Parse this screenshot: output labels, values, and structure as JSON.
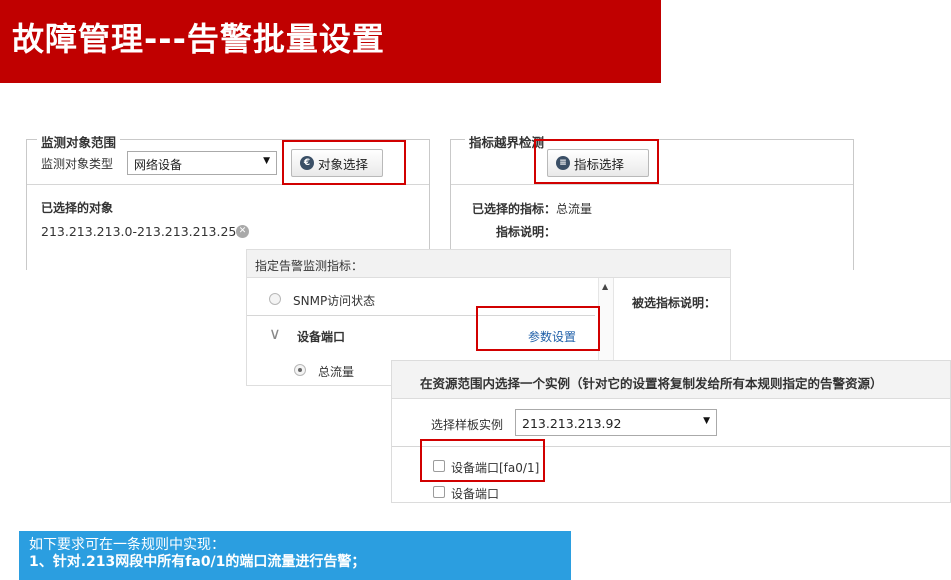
{
  "title": "故障管理---告警批量设置",
  "monitor_scope": {
    "legend": "监测对象范围",
    "type_label": "监测对象类型",
    "type_value": "网络设备",
    "select_button": "对象选择",
    "selected_label": "已选择的对象",
    "selected_value": "213.213.213.0-213.213.213.255"
  },
  "metric_check": {
    "legend": "指标越界检测",
    "select_button": "指标选择",
    "selected_metric_label": "已选择的指标：",
    "selected_metric_value": "总流量",
    "metric_desc_label": "指标说明："
  },
  "metric_panel": {
    "header": "指定告警监测指标：",
    "items": {
      "snmp": "SNMP访问状态",
      "device_port": "设备端口",
      "total_flow": "总流量"
    },
    "param_link": "参数设置",
    "desc_label": "被选指标说明："
  },
  "instance_panel": {
    "header": "在资源范围内选择一个实例（针对它的设置将复制发给所有本规则指定的告警资源）",
    "template_label": "选择样板实例",
    "template_value": "213.213.213.92",
    "options": {
      "port_fa": "设备端口[fa0/1]",
      "port": "设备端口"
    }
  },
  "note": {
    "line1": "如下要求可在一条规则中实现：",
    "line2": "1、针对.213网段中所有fa0/1的端口流量进行告警；"
  }
}
